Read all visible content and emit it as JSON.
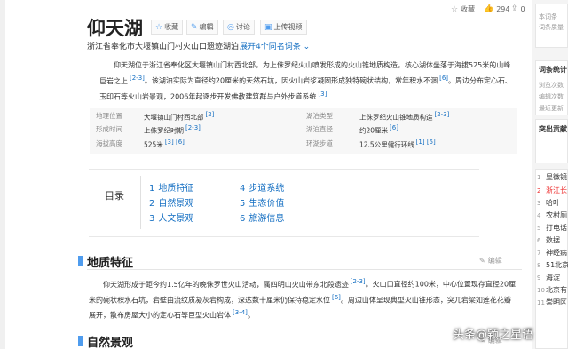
{
  "title": "仰天湖",
  "toolbar": {
    "collect": "收藏",
    "view": "编辑",
    "discuss": "讨论",
    "upload": "上传视频"
  },
  "top_actions": {
    "favorite": "收藏",
    "likes": "294",
    "share_count": "0"
  },
  "subtitle": "浙江省奉化市大堰镇山门村火山口遗迹湖泊",
  "expand": "展开4个同名词条",
  "intro": "仰天湖位于浙江省奉化区大堰镇山门村西北部，为上侏罗纪火山喷发形成的火山锥地质构造，核心湖体坐落于海拔525米的山峰巨岩之上",
  "intro_ref1": "[2-3]",
  "intro_2": "。该湖泊实际为直径约20厘米的天然石坑，因火山岩浆凝固形成独特碗状结构，常年积水不涸",
  "intro_ref2": "[6]",
  "intro_3": "。周边分布定心石、玉印石等火山岩景观，2006年起逐步开发佛教建筑群与户外步道系统",
  "intro_ref3": "[3]",
  "basic_info": {
    "left": [
      {
        "key": "地理位置",
        "value": "大堰镇山门村西北部",
        "ref": "[2]"
      },
      {
        "key": "形成时间",
        "value": "上侏罗纪时期",
        "ref": "[2-3]"
      },
      {
        "key": "海拔高度",
        "value": "525米",
        "ref": "[3] [6]"
      }
    ],
    "right": [
      {
        "key": "湖泊类型",
        "value": "上侏罗纪火山锥地质构造",
        "ref": "[2-3]"
      },
      {
        "key": "湖泊直径",
        "value": "约20厘米",
        "ref": "[6]"
      },
      {
        "key": "环湖步道",
        "value": "12.5公里健行环线",
        "ref": "[1] [5]"
      }
    ]
  },
  "toc": {
    "label": "目录",
    "items": [
      {
        "num": "1",
        "label": "地质特征"
      },
      {
        "num": "2",
        "label": "自然景观"
      },
      {
        "num": "3",
        "label": "人文景观"
      },
      {
        "num": "4",
        "label": "步道系统"
      },
      {
        "num": "5",
        "label": "生态价值"
      },
      {
        "num": "6",
        "label": "旅游信息"
      }
    ]
  },
  "section1": {
    "title": "地质特征",
    "edit": "编辑",
    "text1": "仰天湖形成于距今约1.5亿年的晚侏罗世火山活动，属四明山火山带东北段遗迹",
    "ref1": "[2-3]",
    "text2": "。火山口直径约100米，中心位置现存直径20厘米的碗状积水石坑，岩壁由流纹质凝灰岩构成，深达数十厘米仍保持稳定水位",
    "ref2": "[6]",
    "text3": "。周边山体呈现典型火山锥形态，突兀岩梁如莲花花瓣展开，散布房屋大小的定心石等巨型火山岩体",
    "ref3": "[3-4]",
    "text3_end": "。"
  },
  "section2": {
    "title": "自然景观",
    "edit": "编辑"
  },
  "right_rail": {
    "box1": [
      "本词条",
      "词条质量"
    ],
    "box2_head": "词条统计",
    "box2": [
      "浏览次数",
      "编辑次数",
      "最近更新"
    ],
    "box3_head": "突出贡献",
    "hot_list": [
      {
        "num": "1",
        "label": "显微镜"
      },
      {
        "num": "2",
        "label": "浙江长"
      },
      {
        "num": "3",
        "label": "哈叶"
      },
      {
        "num": "4",
        "label": "农村厕"
      },
      {
        "num": "5",
        "label": "打电话"
      },
      {
        "num": "6",
        "label": "数据"
      },
      {
        "num": "7",
        "label": "神经病"
      },
      {
        "num": "8",
        "label": "51北京"
      },
      {
        "num": "9",
        "label": "海淀"
      },
      {
        "num": "10",
        "label": "北京有"
      },
      {
        "num": "11",
        "label": "崇明区"
      }
    ]
  },
  "watermark": "头条@颖之星语",
  "colors": {
    "link": "#136ec2",
    "accent": "#4f9cee",
    "hot": "#e33"
  }
}
